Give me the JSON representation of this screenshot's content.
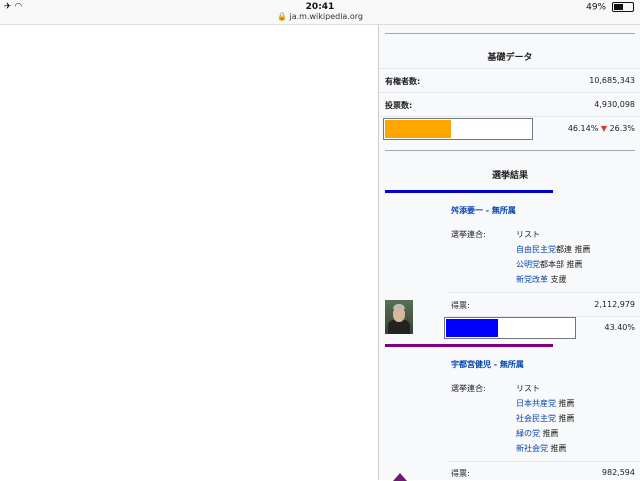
{
  "status_bar": {
    "left_icons": "✈ ◠",
    "time": "20:41",
    "url": "🔒 ja.m.wikipedia.org",
    "battery_percent": "49%",
    "battery_level": 0.49
  },
  "infobox": {
    "basic_title": "基礎データ",
    "voters_label": "有権者数:",
    "voters_value": "10,685,343",
    "votes_label": "投票数:",
    "votes_value": "4,930,098",
    "turnout_pct": "46.14%",
    "turnout_change_arrow": "▼",
    "turnout_change": "26.3%",
    "turnout_fraction": 0.4614,
    "turnout_color": "#ffa500",
    "results_title": "選挙結果",
    "candidates": [
      {
        "name": "舛添要一 - 無所属",
        "line_color": "#0000cc",
        "coalition_label": "選挙連合:",
        "list_label": "リスト",
        "coalition": [
          {
            "link": "自由民主党",
            "rest": "都連 推薦"
          },
          {
            "link": "公明党",
            "rest": "都本部 推薦"
          },
          {
            "link": "新党改革",
            "rest": " 支援"
          }
        ],
        "votes_label": "得票:",
        "votes": "2,112,979",
        "pct": "43.40%",
        "fraction": 0.434,
        "bar_color": "#0000ff",
        "photo_icon": "candidate-photo"
      },
      {
        "name": "宇都宮健児 - 無所属",
        "line_color": "#800080",
        "coalition_label": "選挙連合:",
        "list_label": "リスト",
        "coalition": [
          {
            "link": "日本共産党",
            "rest": " 推薦"
          },
          {
            "link": "社会民主党",
            "rest": " 推薦"
          },
          {
            "link": "緑の党",
            "rest": " 推薦"
          },
          {
            "link": "新社会党",
            "rest": " 推薦"
          }
        ],
        "votes_label": "得票:",
        "votes": "982,594"
      }
    ]
  }
}
